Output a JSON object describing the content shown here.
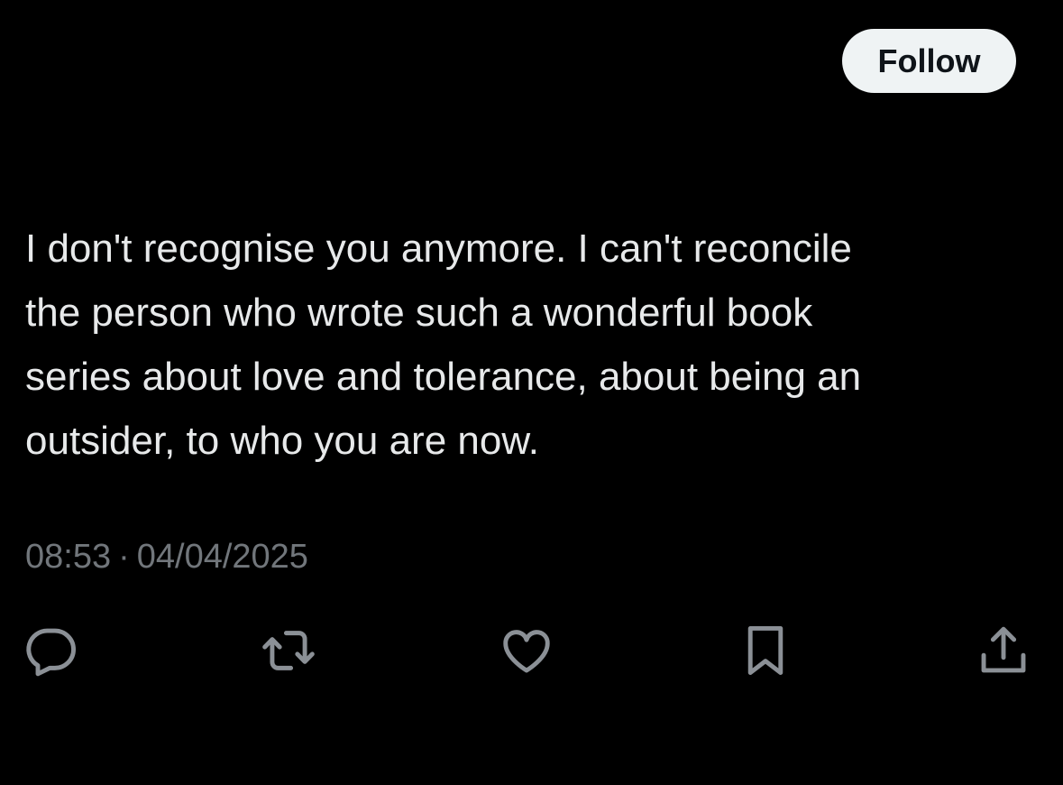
{
  "follow_button": {
    "label": "Follow"
  },
  "tweet": {
    "text": "I don't recognise you anymore. I can't reconcile\nthe person who wrote such a wonderful book\nseries about love and tolerance, about being an\noutsider, to who you are now.",
    "time": "08:53",
    "separator": "·",
    "date": "04/04/2025"
  },
  "actions": [
    {
      "name": "reply",
      "icon": "speech-bubble-icon"
    },
    {
      "name": "repost",
      "icon": "repost-arrows-icon"
    },
    {
      "name": "like",
      "icon": "heart-icon"
    },
    {
      "name": "bookmark",
      "icon": "bookmark-icon"
    },
    {
      "name": "share",
      "icon": "share-upload-icon"
    }
  ],
  "colors": {
    "background": "#000000",
    "text": "#e7e9ea",
    "secondary_text": "#71767b",
    "icon": "#8b9096",
    "button_background": "#eff3f4",
    "button_text": "#0f1419"
  }
}
